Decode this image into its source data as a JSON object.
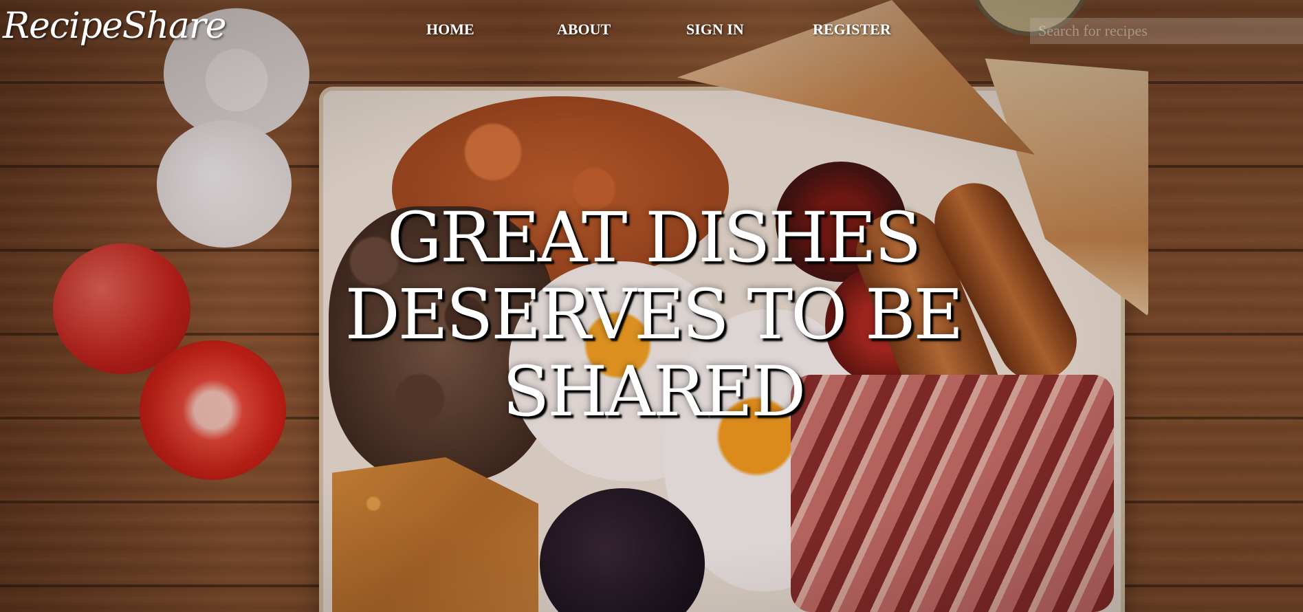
{
  "site": {
    "logo": "RecipeShare"
  },
  "nav": {
    "items": [
      {
        "label": "HOME"
      },
      {
        "label": "ABOUT"
      },
      {
        "label": "SIGN IN"
      },
      {
        "label": "REGISTER"
      }
    ]
  },
  "search": {
    "placeholder": "Search for recipes",
    "value": ""
  },
  "hero": {
    "headline": "GREAT DISHES DESERVES TO BE SHARED",
    "background_image": "full-english-breakfast-photo"
  },
  "colors": {
    "text": "#ffffff",
    "wood": "#7a4727",
    "plate": "#efe6d6"
  }
}
